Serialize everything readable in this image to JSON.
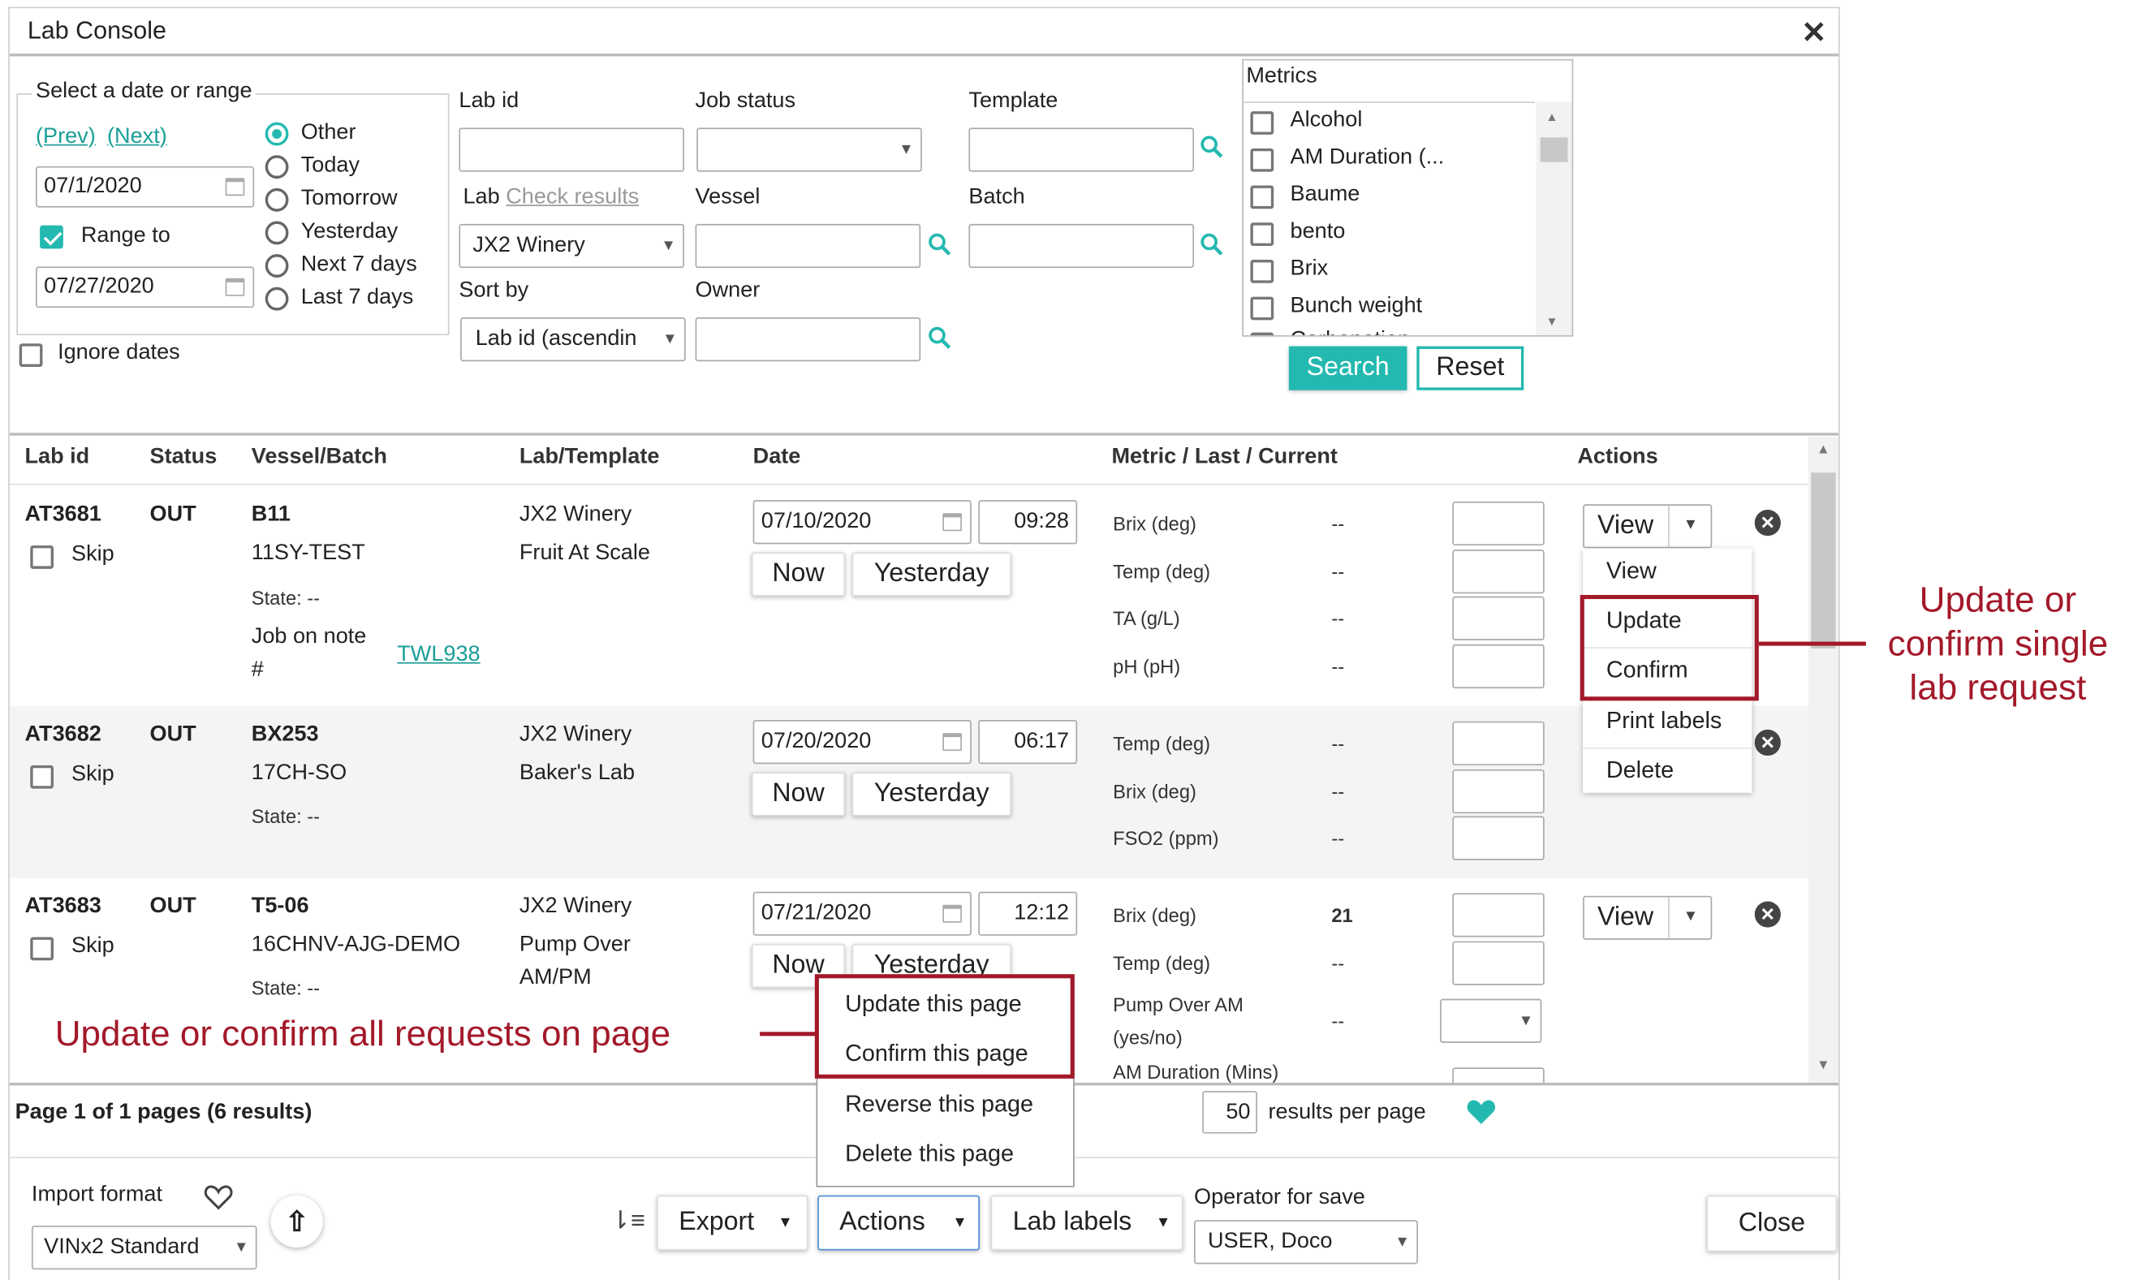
{
  "title": "Lab Console",
  "date_panel": {
    "legend": "Select a date or range",
    "prev": "(Prev)",
    "next": "(Next)",
    "date_from": "07/1/2020",
    "range_to_label": "Range to",
    "range_to_checked": true,
    "date_to": "07/27/2020",
    "ignore_dates": "Ignore dates",
    "radios": [
      "Other",
      "Today",
      "Tomorrow",
      "Yesterday",
      "Next 7 days",
      "Last 7 days"
    ],
    "selected_radio": "Other"
  },
  "filters": {
    "lab_id": "Lab id",
    "job_status": "Job status",
    "template": "Template",
    "lab_prefix": "Lab",
    "check_results": "Check results",
    "lab_value": "JX2 Winery",
    "vessel": "Vessel",
    "batch": "Batch",
    "sort_by": "Sort by",
    "sort_value": "Lab id (ascendin",
    "owner": "Owner"
  },
  "metrics": {
    "title": "Metrics",
    "items": [
      "Alcohol",
      "AM Duration (...",
      "Baume",
      "bento",
      "Brix",
      "Bunch weight"
    ],
    "cut_item": "Carbonation"
  },
  "buttons": {
    "search": "Search",
    "reset": "Reset",
    "now": "Now",
    "yesterday": "Yesterday",
    "view": "View",
    "export": "Export",
    "actions": "Actions",
    "lab_labels": "Lab labels",
    "close": "Close"
  },
  "table": {
    "headers": [
      "Lab id",
      "Status",
      "Vessel/Batch",
      "Lab/Template",
      "Date",
      "Metric / Last / Current",
      "Actions"
    ],
    "skip_label": "Skip",
    "state_label": "State: --",
    "rows": [
      {
        "lab_id": "AT3681",
        "status": "OUT",
        "vessel": "B11",
        "batch": "11SY-TEST",
        "lab": "JX2 Winery",
        "template": "Fruit At Scale",
        "date": "07/10/2020",
        "time": "09:28",
        "note_label": "Job on note",
        "note_hash": "#",
        "note_link": "TWL938",
        "metrics": [
          {
            "name": "Brix (deg)",
            "last": "--"
          },
          {
            "name": "Temp (deg)",
            "last": "--"
          },
          {
            "name": "TA (g/L)",
            "last": "--"
          },
          {
            "name": "pH (pH)",
            "last": "--"
          }
        ]
      },
      {
        "lab_id": "AT3682",
        "status": "OUT",
        "vessel": "BX253",
        "batch": "17CH-SO",
        "lab": "JX2 Winery",
        "template": "Baker's Lab",
        "date": "07/20/2020",
        "time": "06:17",
        "metrics": [
          {
            "name": "Temp (deg)",
            "last": "--"
          },
          {
            "name": "Brix (deg)",
            "last": "--"
          },
          {
            "name": "FSO2 (ppm)",
            "last": "--"
          }
        ]
      },
      {
        "lab_id": "AT3683",
        "status": "OUT",
        "vessel": "T5-06",
        "batch": "16CHNV-AJG-DEMO",
        "lab": "JX2 Winery",
        "template_line1": "Pump Over",
        "template_line2": "AM/PM",
        "date": "07/21/2020",
        "time": "12:12",
        "metrics": [
          {
            "name": "Brix (deg)",
            "last": "21"
          },
          {
            "name": "Temp (deg)",
            "last": "--"
          },
          {
            "name": "Pump Over AM",
            "name2": "(yes/no)",
            "last": "--"
          },
          {
            "name": "AM Duration (Mins)",
            "last": ""
          }
        ]
      }
    ]
  },
  "view_menu": [
    "View",
    "Update",
    "Confirm",
    "Print labels",
    "Delete"
  ],
  "actions_menu": [
    "Update this page",
    "Confirm this page",
    "Reverse this page",
    "Delete this page"
  ],
  "pager": {
    "text": "Page 1 of 1 pages (6 results)",
    "per_page": "50",
    "per_page_label": "results per page"
  },
  "bottom": {
    "import_format": "Import format",
    "import_value": "VINx2 Standard",
    "operator_label": "Operator for save",
    "operator_value": "USER, Doco"
  },
  "annotations": {
    "single_line1": "Update or",
    "single_line2": "confirm single",
    "single_line3": "lab request",
    "all": "Update or confirm all requests on page"
  },
  "colors": {
    "accent": "#24b9b0",
    "annotation": "#a3192a"
  }
}
